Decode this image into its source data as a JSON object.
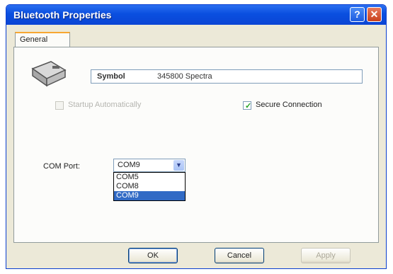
{
  "window": {
    "title": "Bluetooth Properties"
  },
  "title_buttons": {
    "help": "?",
    "close": "✕"
  },
  "tabs": [
    {
      "label": "General"
    }
  ],
  "device": {
    "icon": "device-icon",
    "name_part1": "Symbol",
    "name_part2": "345800 Spectra"
  },
  "options": {
    "startup_label": "Startup Automatically",
    "startup_checked": false,
    "startup_enabled": false,
    "secure_label": "Secure Connection",
    "secure_checked": true
  },
  "com_port": {
    "label": "COM Port:",
    "selected": "COM9",
    "dropdown_open": true,
    "options": [
      "COM5",
      "COM8",
      "COM9"
    ],
    "highlighted": "COM9"
  },
  "buttons": {
    "ok": "OK",
    "cancel": "Cancel",
    "apply": "Apply"
  },
  "colors": {
    "title_bar": "#0a4fe0",
    "window_bg": "#ece9d8",
    "selection": "#316ac5"
  }
}
